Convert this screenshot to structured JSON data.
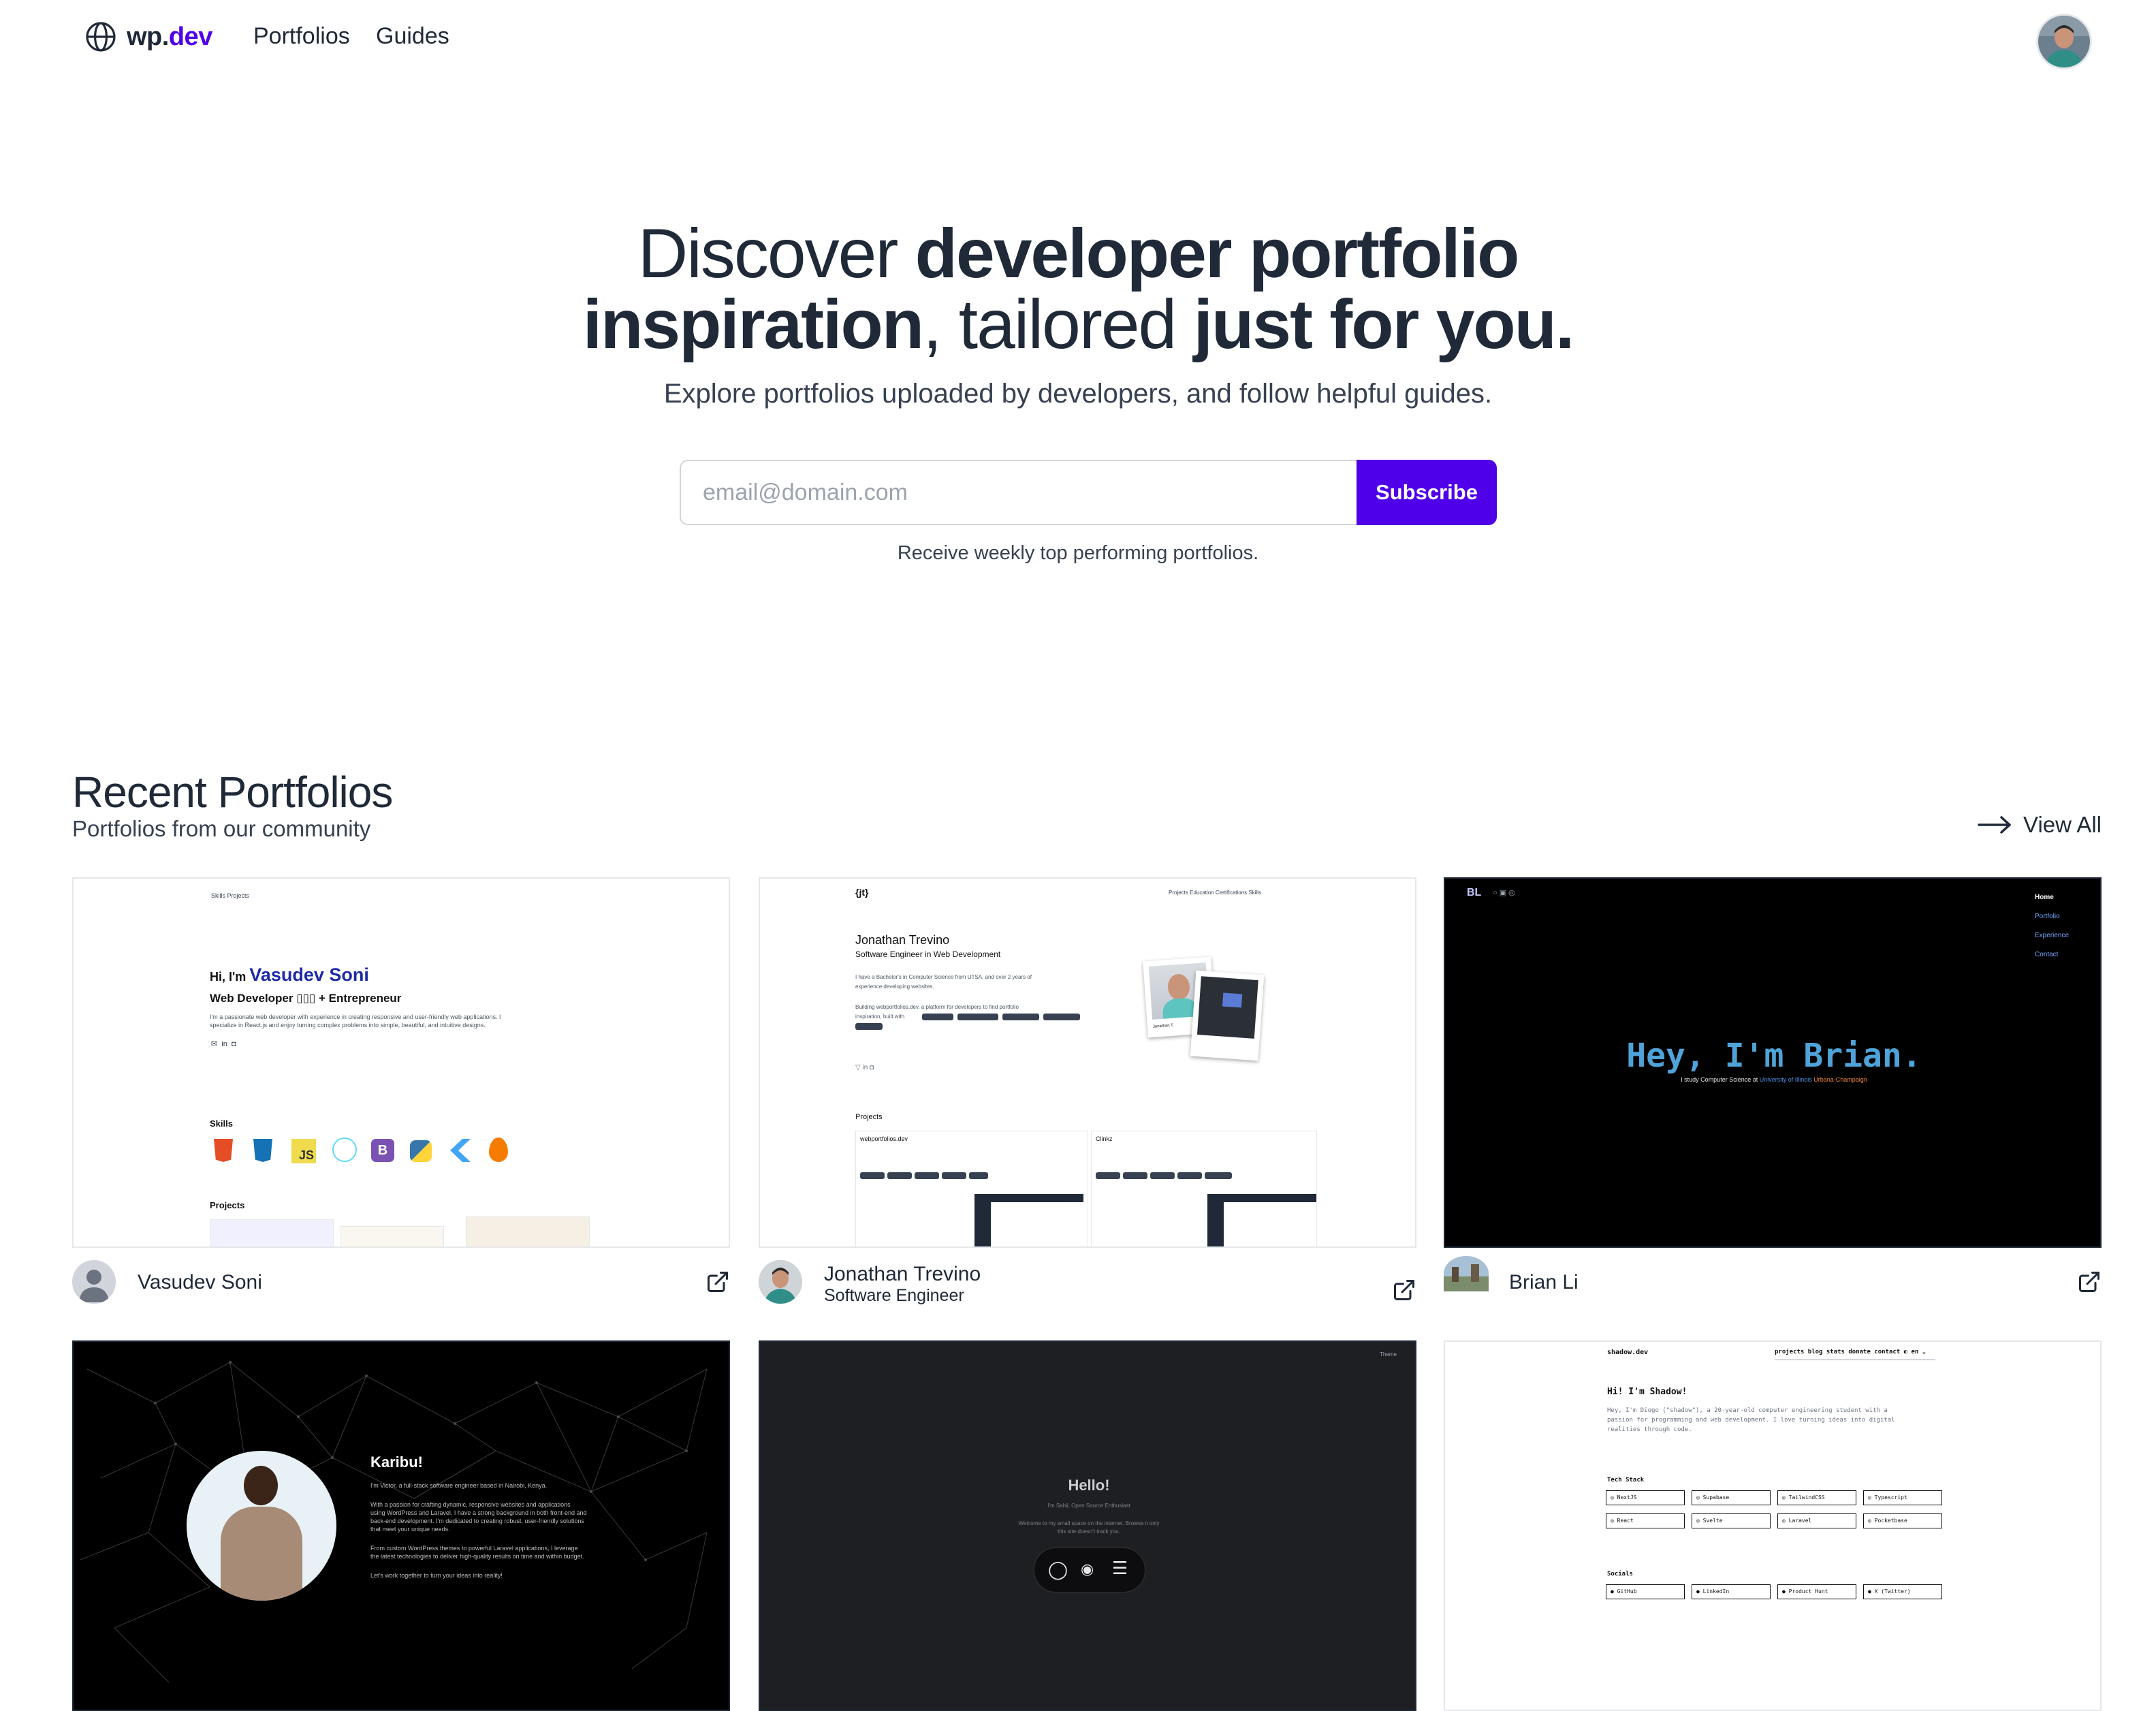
{
  "nav": {
    "brand_prefix": "wp",
    "brand_dot": ".",
    "brand_tld": "dev",
    "links": [
      "Portfolios",
      "Guides"
    ]
  },
  "hero": {
    "title_parts": [
      "Discover ",
      "developer portfolio",
      "inspiration",
      ", tailored ",
      "just for you."
    ],
    "subtitle": "Explore portfolios uploaded by developers, and follow helpful guides.",
    "email_placeholder": "email@domain.com",
    "subscribe_label": "Subscribe",
    "note": "Receive weekly top performing portfolios."
  },
  "recent": {
    "title": "Recent Portfolios",
    "subtitle": "Portfolios from our community",
    "view_all": "View All"
  },
  "cards": [
    {
      "name": "Vasudev Soni",
      "role": ""
    },
    {
      "name": "Jonathan Trevino",
      "role": "Software Engineer"
    },
    {
      "name": "Brian Li",
      "role": ""
    }
  ],
  "thumbs": {
    "vasudev": {
      "nav": "Skills  Projects",
      "hi": "Hi, I'm ",
      "name": "Vasudev Soni",
      "title": "Web Developer ▯▯▯ + Entrepreneur",
      "bio1": "I'm a passionate web developer with experience in creating responsive and user-friendly web applications. I",
      "bio2": "specialize in React.js and enjoy turning complex problems into simple, beautiful, and intuitive designs.",
      "skills": "Skills",
      "projects": "Projects"
    },
    "jonathan": {
      "logo": "{jt}",
      "nav": "Projects   Education   Certifications   Skills",
      "name": "Jonathan Trevino",
      "title": "Software Engineer in Web Development",
      "bio1": "I have a Bachelor's in Computer Science from UTSA, and over 2 years of",
      "bio2": "experience developing websites.",
      "bio3": "Building webportfolios.dev, a platform for developers to find portfolio",
      "bio4": "inspiration, built with",
      "projects": "Projects",
      "p1": "webportfolios.dev",
      "p2": "Clinkz",
      "polaroid": "Jonathan T."
    },
    "brian": {
      "logo": "BL",
      "menu": [
        "Home",
        "Portfolio",
        "Experience",
        "Contact"
      ],
      "hello": "Hey, I'm Brian.",
      "line_start": "I study Computer Science at ",
      "line_uni": "University of Illinois",
      "line_city": " Urbana-Champaign"
    },
    "victor": {
      "title": "Karibu!",
      "p1": "I'm Victor, a full-stack software engineer based in Nairobi, Kenya.",
      "p2": "With a passion for crafting dynamic, responsive websites and applications",
      "p3": "using WordPress and Laravel. I have a strong background in both front-end and",
      "p4": "back-end development. I'm dedicated to creating robust, user-friendly solutions",
      "p5": "that meet your unique needs.",
      "p6": "From custom WordPress themes to powerful Laravel applications, I leverage",
      "p7": "the latest technologies to deliver high-quality results on time and within budget.",
      "p8": "Let's work together to turn your ideas into reality!"
    },
    "sahil": {
      "theme": "Theme",
      "hello": "Hello!",
      "tag": "I'm Sahil, Open Source Enthusiast",
      "welcome": "Welcome to my small space on the internet. Browse it only",
      "welcome2": "this site doesn't track you."
    },
    "shadow": {
      "logo": "shadow.dev",
      "nav": "projects  blog  stats  donate  contact  ◐  en ⌄",
      "hi": "Hi! I'm Shadow!",
      "bio1": "Hey, I'm Diogo (\"shadow\"), a 20-year-old computer engineering student with a",
      "bio2": "passion for programming and web development. I love turning ideas into digital",
      "bio3": "realities through code.",
      "stack": "Tech Stack",
      "stack_items": [
        "NextJS",
        "Supabase",
        "TailwindCSS",
        "Typescript",
        "React",
        "Svelte",
        "Laravel",
        "Pocketbase"
      ],
      "socials": "Socials",
      "social_items": [
        "GitHub",
        "LinkedIn",
        "Product Hunt",
        "X (Twitter)"
      ]
    }
  },
  "colors": {
    "accent": "#4f00e8",
    "text": "#1f2937"
  }
}
